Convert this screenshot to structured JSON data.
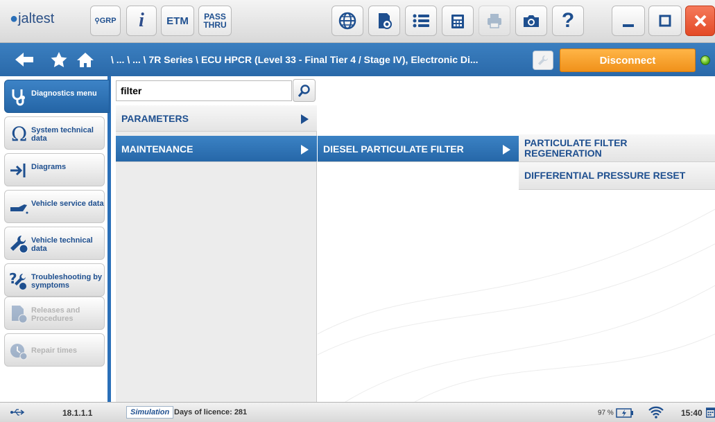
{
  "app": {
    "logo_text": "jaltest"
  },
  "toolbar": {
    "grp_label": "GRP",
    "info_label": "i",
    "etm_label": "ETM",
    "pass_line1": "PASS",
    "pass_line2": "THRU",
    "help_label": "?"
  },
  "nav": {
    "breadcrumb": "\\ ... \\ ... \\ 7R Series \\ ECU HPCR (Level 33 - Final Tier 4 / Stage IV), Electronic Di...",
    "disconnect_label": "Disconnect"
  },
  "sidebar": {
    "items": [
      {
        "label": "Diagnostics menu",
        "icon": "stethoscope-icon",
        "active": true
      },
      {
        "label": "System technical data",
        "icon": "omega-icon"
      },
      {
        "label": "Diagrams",
        "icon": "diagram-arrow-icon"
      },
      {
        "label": "Vehicle service data",
        "icon": "oil-can-icon"
      },
      {
        "label": "Vehicle technical data",
        "icon": "wrench-globe-icon"
      },
      {
        "label": "Troubleshooting by symptoms",
        "icon": "troubleshooting-icon"
      },
      {
        "label": "Releases and Procedures",
        "icon": "procedures-icon",
        "disabled": true
      },
      {
        "label": "Repair times",
        "icon": "repair-times-icon",
        "disabled": true
      }
    ]
  },
  "search": {
    "value": "filter"
  },
  "menu": {
    "level1": [
      "PARAMETERS",
      "MAINTENANCE"
    ],
    "level2": [
      "DIESEL PARTICULATE FILTER"
    ],
    "level3": [
      "PARTICULATE FILTER REGENERATION",
      "DIFFERENTIAL PRESSURE RESET"
    ]
  },
  "status": {
    "version": "18.1.1.1",
    "mode": "Simulation",
    "licence": "Days of licence: 281",
    "battery": "97 %",
    "time": "15:40"
  },
  "colors": {
    "accent": "#2a6fb8",
    "disconnect": "#f39a22",
    "close": "#e34a26"
  }
}
